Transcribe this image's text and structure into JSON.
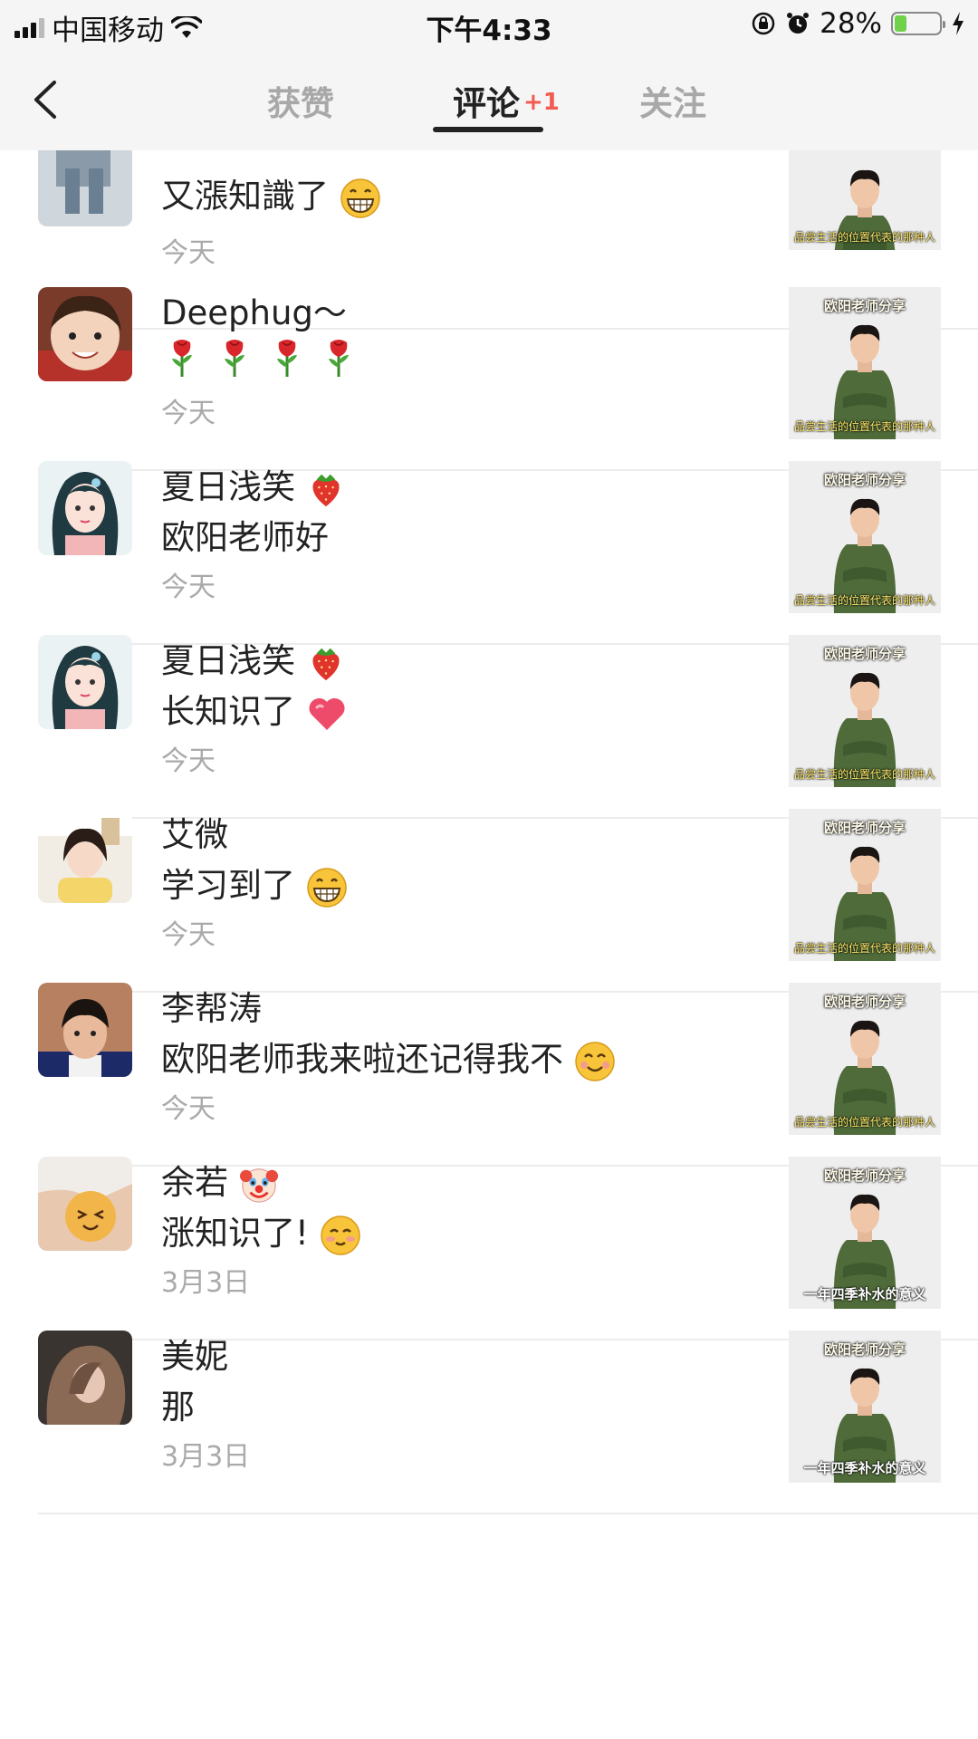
{
  "status_bar": {
    "carrier": "中国移动",
    "time": "下午4:33",
    "battery": "28%",
    "battery_level": 0.28
  },
  "tabs": [
    {
      "label": "获赞"
    },
    {
      "label": "评论",
      "badge": "+1"
    },
    {
      "label": "关注"
    }
  ],
  "comments": [
    {
      "username": "",
      "text": "又漲知識了",
      "emoji": "grin-icon",
      "time": "今天",
      "thumb_title": "",
      "thumb_caption": "品尝生活的位置代表的那种人"
    },
    {
      "username": "Deephug～",
      "text": "",
      "emoji": "rose-icon",
      "time": "今天",
      "thumb_title": "欧阳老师分享",
      "thumb_caption": "品尝生活的位置代表的那种人"
    },
    {
      "username": "夏日浅笑",
      "username_emoji": "strawberry-icon",
      "text": "欧阳老师好",
      "time": "今天",
      "thumb_title": "欧阳老师分享",
      "thumb_caption": "品尝生活的位置代表的那种人"
    },
    {
      "username": "夏日浅笑",
      "username_emoji": "strawberry-icon",
      "text": "长知识了",
      "emoji": "heart-icon",
      "time": "今天",
      "thumb_title": "欧阳老师分享",
      "thumb_caption": "品尝生活的位置代表的那种人"
    },
    {
      "username": "艾微",
      "text": "学习到了",
      "emoji": "grin-icon",
      "time": "今天",
      "thumb_title": "欧阳老师分享",
      "thumb_caption": "品尝生活的位置代表的那种人"
    },
    {
      "username": "李帮涛",
      "text": "欧阳老师我来啦还记得我不",
      "emoji": "smile-icon",
      "time": "今天",
      "thumb_title": "欧阳老师分享",
      "thumb_caption": "品尝生活的位置代表的那种人"
    },
    {
      "username": "余若",
      "username_emoji": "clown-icon",
      "text": "涨知识了!",
      "emoji": "blush-icon",
      "time": "3月3日",
      "thumb_title": "欧阳老师分享",
      "thumb_caption": "一年四季补水的意义"
    },
    {
      "username": "美妮",
      "text": "那",
      "time": "3月3日",
      "thumb_title": "欧阳老师分享",
      "thumb_caption": "一年四季补水的意义"
    }
  ],
  "colors": {
    "accent_badge": "#f25b52",
    "header_bg": "#f5f5f5",
    "active_tab": "#222222",
    "inactive_tab": "#a8a8a8"
  }
}
